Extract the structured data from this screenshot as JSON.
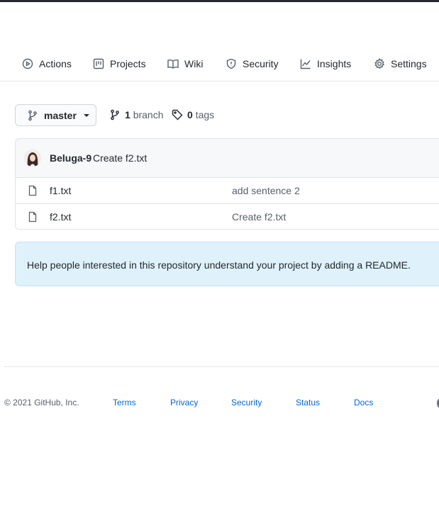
{
  "tabs": [
    {
      "label": "Actions",
      "icon": "play-icon"
    },
    {
      "label": "Projects",
      "icon": "project-board-icon"
    },
    {
      "label": "Wiki",
      "icon": "book-icon"
    },
    {
      "label": "Security",
      "icon": "shield-icon"
    },
    {
      "label": "Insights",
      "icon": "graph-icon"
    },
    {
      "label": "Settings",
      "icon": "gear-icon"
    }
  ],
  "branch_selector": {
    "label": "master"
  },
  "branches": {
    "count": "1",
    "label": "branch"
  },
  "tags": {
    "count": "0",
    "label": "tags"
  },
  "latest_commit": {
    "author": "Beluga-9",
    "message": "Create f2.txt"
  },
  "files": [
    {
      "name": "f1.txt",
      "commit_message": "add sentence 2"
    },
    {
      "name": "f2.txt",
      "commit_message": "Create f2.txt"
    }
  ],
  "readme_prompt": "Help people interested in this repository understand your project by adding a README.",
  "footer": {
    "copyright": "© 2021 GitHub, Inc.",
    "links": [
      "Terms",
      "Privacy",
      "Security",
      "Status",
      "Docs"
    ]
  },
  "colors": {
    "link": "#0366d6",
    "readme_bg": "#dff1fb",
    "border": "#e1e4e8",
    "topbar": "#24292e"
  }
}
